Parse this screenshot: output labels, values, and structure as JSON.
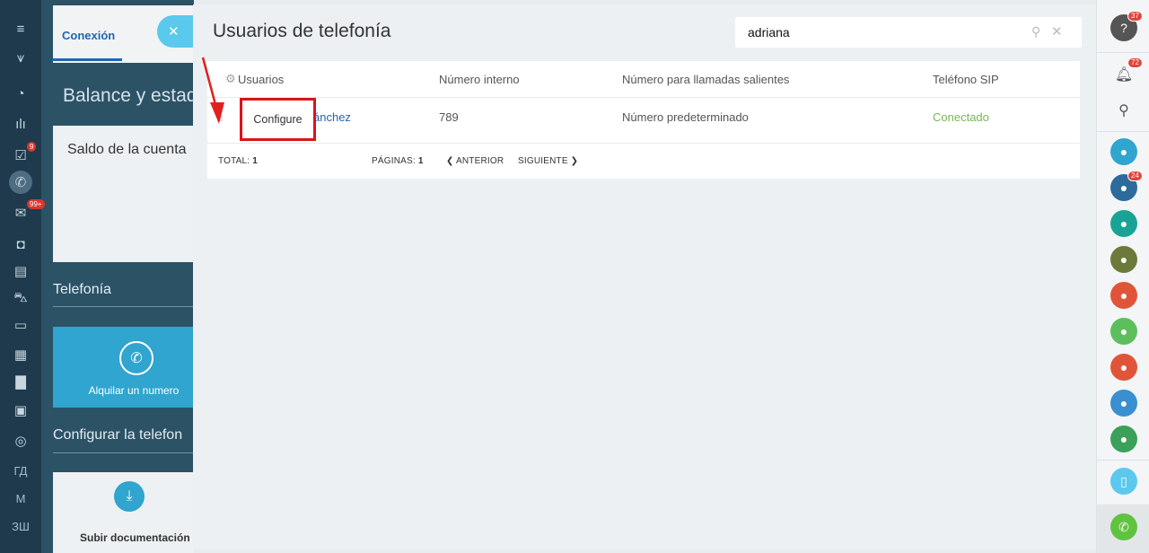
{
  "left_nav": {
    "items": [
      {
        "icon": "menu-icon",
        "glyph": "≡"
      },
      {
        "icon": "filter-icon",
        "glyph": "⩛"
      },
      {
        "icon": "clock-icon",
        "glyph": "◔"
      },
      {
        "icon": "chart-icon",
        "glyph": "ılı"
      },
      {
        "icon": "tasks-icon",
        "glyph": "☑",
        "badge": "9"
      },
      {
        "icon": "phone-icon",
        "glyph": "✆",
        "active": true
      },
      {
        "icon": "mail-icon",
        "glyph": "✉",
        "badge": "99+"
      },
      {
        "icon": "robot-icon",
        "glyph": "◘"
      },
      {
        "icon": "store-icon",
        "glyph": "▤"
      },
      {
        "icon": "cart-icon",
        "glyph": "⛍"
      },
      {
        "icon": "window-icon",
        "glyph": "▭"
      },
      {
        "icon": "apps-icon",
        "glyph": "▦"
      },
      {
        "icon": "document-icon",
        "glyph": "▇"
      },
      {
        "icon": "list-icon",
        "glyph": "▣"
      },
      {
        "icon": "target-icon",
        "glyph": "◎"
      }
    ],
    "text_items": [
      "ГД",
      "М",
      "ЗШ"
    ]
  },
  "background_page": {
    "tab_connection": "Conexión",
    "balance_title": "Balance y estad",
    "account_balance": "Saldo de la cuenta",
    "telephony_section": "Telefonía",
    "rent_number": "Alquilar un numero",
    "configure_section": "Configurar la telefon",
    "upload_docs": "Subir documentación"
  },
  "slider": {
    "close_glyph": "✕",
    "title": "Usuarios de telefonía",
    "search": {
      "value": "adriana",
      "search_glyph": "⚲",
      "clear_glyph": "✕"
    },
    "table": {
      "headers": {
        "users": "Usuarios",
        "internal_number": "Número interno",
        "outgoing_number": "Número para llamadas salientes",
        "sip_phone": "Teléfono SIP"
      },
      "rows": [
        {
          "user_name": "ánchez",
          "internal_number": "789",
          "outgoing_number": "Número predeterminado",
          "sip_status": "Conectado"
        }
      ],
      "footer": {
        "total_label": "TOTAL:",
        "total_value": "1",
        "pages_label": "PÁGINAS:",
        "pages_value": "1",
        "prev": "❮ ANTERIOR",
        "next": "SIGUIENTE ❯"
      }
    },
    "context_menu": {
      "configure": "Configure"
    }
  },
  "right_bar": {
    "help_badge": "37",
    "notifications_badge": "72",
    "groups_badge": "24"
  },
  "colors": {
    "accent_blue": "#2067b0",
    "connected_green": "#7ab553",
    "highlight_red": "#d9141a",
    "sidebar_dark": "#1e3a4c"
  }
}
